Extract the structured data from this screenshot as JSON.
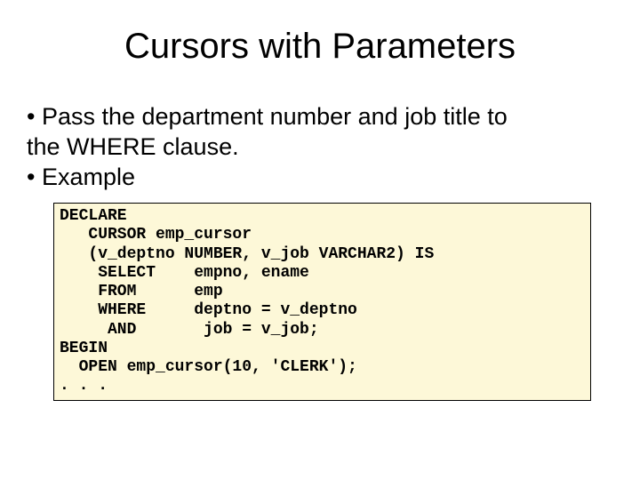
{
  "title": "Cursors with Parameters",
  "bullet1_line1": "• Pass the department number and job title to",
  "bullet1_line2": "the WHERE clause.",
  "bullet2": "• Example",
  "code": "DECLARE\n   CURSOR emp_cursor\n   (v_deptno NUMBER, v_job VARCHAR2) IS\n    SELECT    empno, ename\n    FROM      emp\n    WHERE     deptno = v_deptno\n     AND       job = v_job;\nBEGIN\n  OPEN emp_cursor(10, 'CLERK');\n. . ."
}
